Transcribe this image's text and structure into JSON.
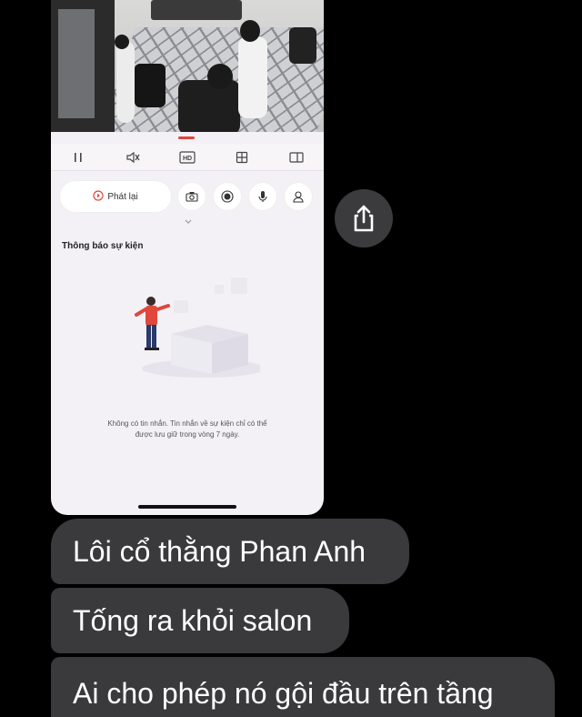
{
  "app": {
    "playback_label": "Phát lại",
    "event_section_title": "Thông báo sự kiện",
    "empty_message_line1": "Không có tin nhắn. Tin nhắn về sự kiện chỉ có thể",
    "empty_message_line2": "được lưu giữ trong vòng 7 ngày.",
    "hd_label": "HD"
  },
  "chat": {
    "messages": [
      "Lôi cổ thằng Phan Anh",
      "Tống ra khỏi salon",
      "Ai cho phép nó gội đầu trên tầng"
    ]
  },
  "colors": {
    "accent": "#e0463c",
    "bubble": "#3a3a3c",
    "background": "#000000"
  },
  "icons": [
    "pause-icon",
    "mute-icon",
    "hd-icon",
    "grid-icon",
    "portrait-icon",
    "playback-icon",
    "camera-icon",
    "record-icon",
    "mic-icon",
    "contact-icon",
    "chevron-down-icon",
    "share-icon"
  ]
}
